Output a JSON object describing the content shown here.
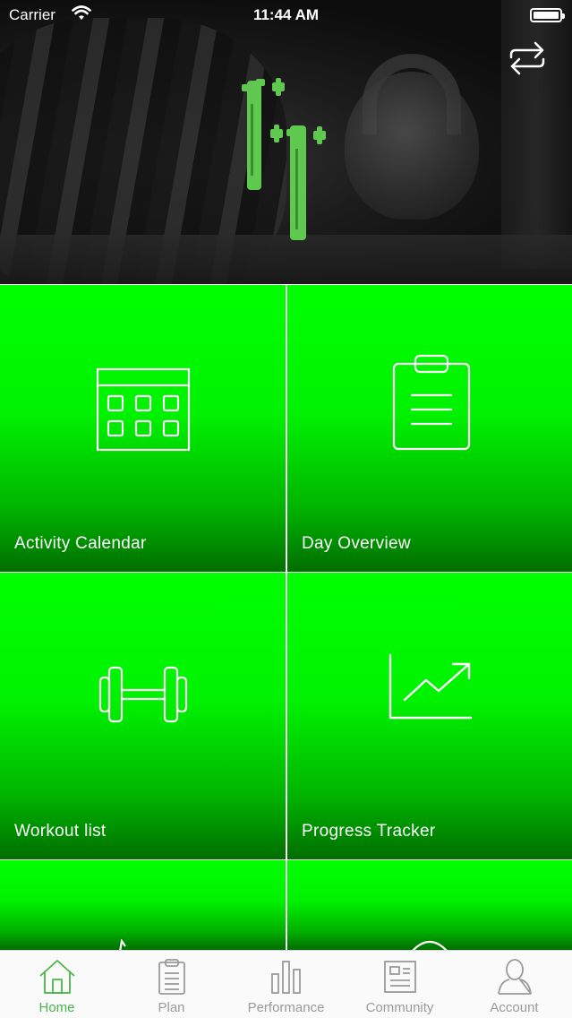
{
  "status_bar": {
    "carrier": "Carrier",
    "time": "11:44 AM"
  },
  "header": {
    "swap_icon": "swap-arrows-icon",
    "logo_color": "#5ec84f"
  },
  "tiles": [
    {
      "label": "Activity Calendar",
      "icon": "calendar-icon"
    },
    {
      "label": "Day Overview",
      "icon": "clipboard-icon"
    },
    {
      "label": "Workout list",
      "icon": "dumbbell-icon"
    },
    {
      "label": "Progress Tracker",
      "icon": "trend-chart-icon"
    }
  ],
  "tile_color": "#00ff00",
  "tabbar": {
    "active_color": "#47b648",
    "inactive_color": "#9a9a9a",
    "items": [
      {
        "label": "Home",
        "icon": "home-icon",
        "active": true
      },
      {
        "label": "Plan",
        "icon": "clipboard-icon",
        "active": false
      },
      {
        "label": "Performance",
        "icon": "bar-chart-icon",
        "active": false
      },
      {
        "label": "Community",
        "icon": "newsfeed-icon",
        "active": false
      },
      {
        "label": "Account",
        "icon": "user-icon",
        "active": false
      }
    ]
  }
}
